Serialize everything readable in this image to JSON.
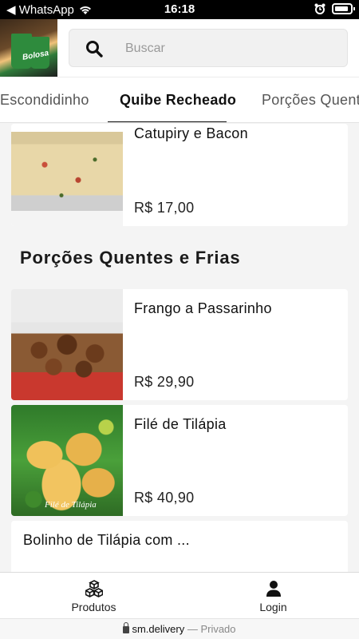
{
  "status_bar": {
    "back_app": "◀ WhatsApp",
    "time": "16:18"
  },
  "header": {
    "logo_text": "Bolosa",
    "search_placeholder": "Buscar"
  },
  "tabs": [
    {
      "label": "Escondidinho",
      "active": false
    },
    {
      "label": "Quibe Recheado",
      "active": true
    },
    {
      "label": "Porções Quentes e Frias",
      "active": false
    }
  ],
  "products_top": [
    {
      "name": "Catupiry e Bacon",
      "price": "R$ 17,00"
    }
  ],
  "section": {
    "title": "Porções Quentes e Frias",
    "items": [
      {
        "name": "Frango a Passarinho",
        "price": "R$ 29,90"
      },
      {
        "name": "Filé de Tilápia",
        "price": "R$ 40,90",
        "image_caption": "Filé de Tilápia"
      },
      {
        "name": "Bolinho de Tilápia com ..."
      }
    ]
  },
  "bottom_nav": [
    {
      "label": "Produtos",
      "icon": "boxes-icon"
    },
    {
      "label": "Login",
      "icon": "user-icon"
    }
  ],
  "url_bar": {
    "domain": "sm.delivery",
    "suffix": "— Privado"
  }
}
